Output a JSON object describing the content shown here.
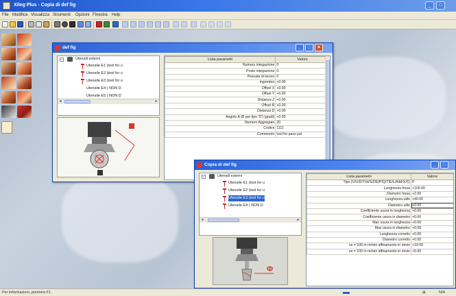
{
  "app": {
    "title": "Xileg Plus - Copia di def fig",
    "minimize_symbol": "_",
    "maximize_symbol": "□"
  },
  "menu": [
    "File",
    "Modifica",
    "Visualizza",
    "Strumenti",
    "Opzioni",
    "Finestra",
    "Help"
  ],
  "toolbar": {
    "icons": [
      "new-icon",
      "open-icon",
      "save-icon",
      "cut-icon",
      "copy-icon",
      "paste-icon",
      "print-icon",
      "preview-icon",
      "zoom-icon",
      "measure-icon",
      "tool-icon",
      "magic-icon",
      "view-icon",
      "grid-icon",
      "align-icon",
      "line-icon",
      "arc-icon",
      "shape-icon"
    ]
  },
  "colors": {
    "accent": "#2b62d9",
    "close": "#d8512c",
    "tool_red": "#c4262e"
  },
  "window1": {
    "title": "def fig",
    "tree": {
      "root": "Utensili esterni",
      "expander": "−",
      "items": [
        "Utensile E1 (tool for u",
        "Utensile E2 (tool for u",
        "Utensile E3 (tool for u",
        "Utensile E4 ( NON D",
        "Utensile E5 ( NON D"
      ]
    },
    "grid": {
      "headers": [
        "Lista parametri",
        "Valore"
      ],
      "rows": [
        {
          "name": "Numero integazione",
          "value": "0"
        },
        {
          "name": "Posto integazione",
          "value": "0"
        },
        {
          "name": "Pescata di lavoro",
          "value": "0"
        },
        {
          "name": "Ingombro",
          "value": "+0.00"
        },
        {
          "name": "Offset X",
          "value": "+0.00"
        },
        {
          "name": "Offset Y",
          "value": "+0.00"
        },
        {
          "name": "Distanza Z",
          "value": "+0.00"
        },
        {
          "name": "Offset R",
          "value": "+0.00"
        },
        {
          "name": "Distanza D",
          "value": "+0.00"
        },
        {
          "name": "Angolo A (B per tipo 'D') (gradi)",
          "value": "+0.00"
        },
        {
          "name": "Numero Aggregato",
          "value": "20"
        },
        {
          "name": "Codice",
          "value": "1111"
        },
        {
          "name": "Commento",
          "value": "tool for pass pal"
        }
      ]
    }
  },
  "window2": {
    "title": "Copia di def fig",
    "tree": {
      "root": "Utensili esterni",
      "expander": "−",
      "items": [
        "Utensile E1 (tool for u",
        "Utensile E2 (tool for u",
        "Utensile E3 (tool for u",
        "Utensile E4 ( NON D"
      ]
    },
    "grid": {
      "headers": [
        "Lista parametri",
        "Valore"
      ],
      "rows": [
        {
          "name": "Tipo (V/U/D/T/H/S/Z/E/P/Q/T/E/L/A/M/X/S)",
          "value": "P"
        },
        {
          "name": "Lunghezza fresa",
          "value": "+100.00"
        },
        {
          "name": "Diametro fresa",
          "value": "+2.00"
        },
        {
          "name": "Lunghezza utile",
          "value": "+40.00"
        },
        {
          "name": "Diametro utile",
          "value": "+0.00"
        },
        {
          "name": "Coefficiente usura in lunghezza",
          "value": "+0.00"
        },
        {
          "name": "Coefficiente usura in diametro",
          "value": "+0.00"
        },
        {
          "name": "Max usura in lunghezza",
          "value": "+0.00"
        },
        {
          "name": "Max usura in diametro",
          "value": "+0.00"
        },
        {
          "name": "Lunghezza corretto",
          "value": "+0.00"
        },
        {
          "name": "Diametro corretto",
          "value": "+0.00"
        },
        {
          "name": "ve = 100 m m/min affinamento in rinvio",
          "value": "+10.00"
        },
        {
          "name": "ve = 100 m m/min affinamento in rinvio",
          "value": "+5.00"
        }
      ]
    },
    "preview_label": "Φ"
  },
  "status": {
    "message": "Per informazioni, premere F1",
    "cell_a": "⊞",
    "cell_b": "N/A"
  }
}
